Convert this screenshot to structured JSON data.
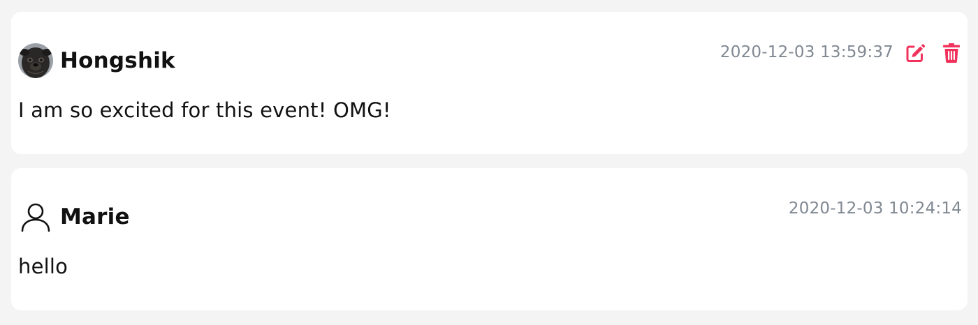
{
  "comments": [
    {
      "author": "Hongshik",
      "timestamp": "2020-12-03 13:59:37",
      "text": "I am so excited for this event! OMG!",
      "avatar": "pug-photo",
      "can_edit": true,
      "actions": [
        "edit-icon",
        "trash-icon"
      ]
    },
    {
      "author": "Marie",
      "timestamp": "2020-12-03 10:24:14",
      "text": "hello",
      "avatar": "user-outline-icon",
      "can_edit": false
    }
  ],
  "colors": {
    "background": "#f4f4f4",
    "card": "#ffffff",
    "text": "#111111",
    "timestamp": "#808892",
    "action_accent": "#f0325c"
  }
}
